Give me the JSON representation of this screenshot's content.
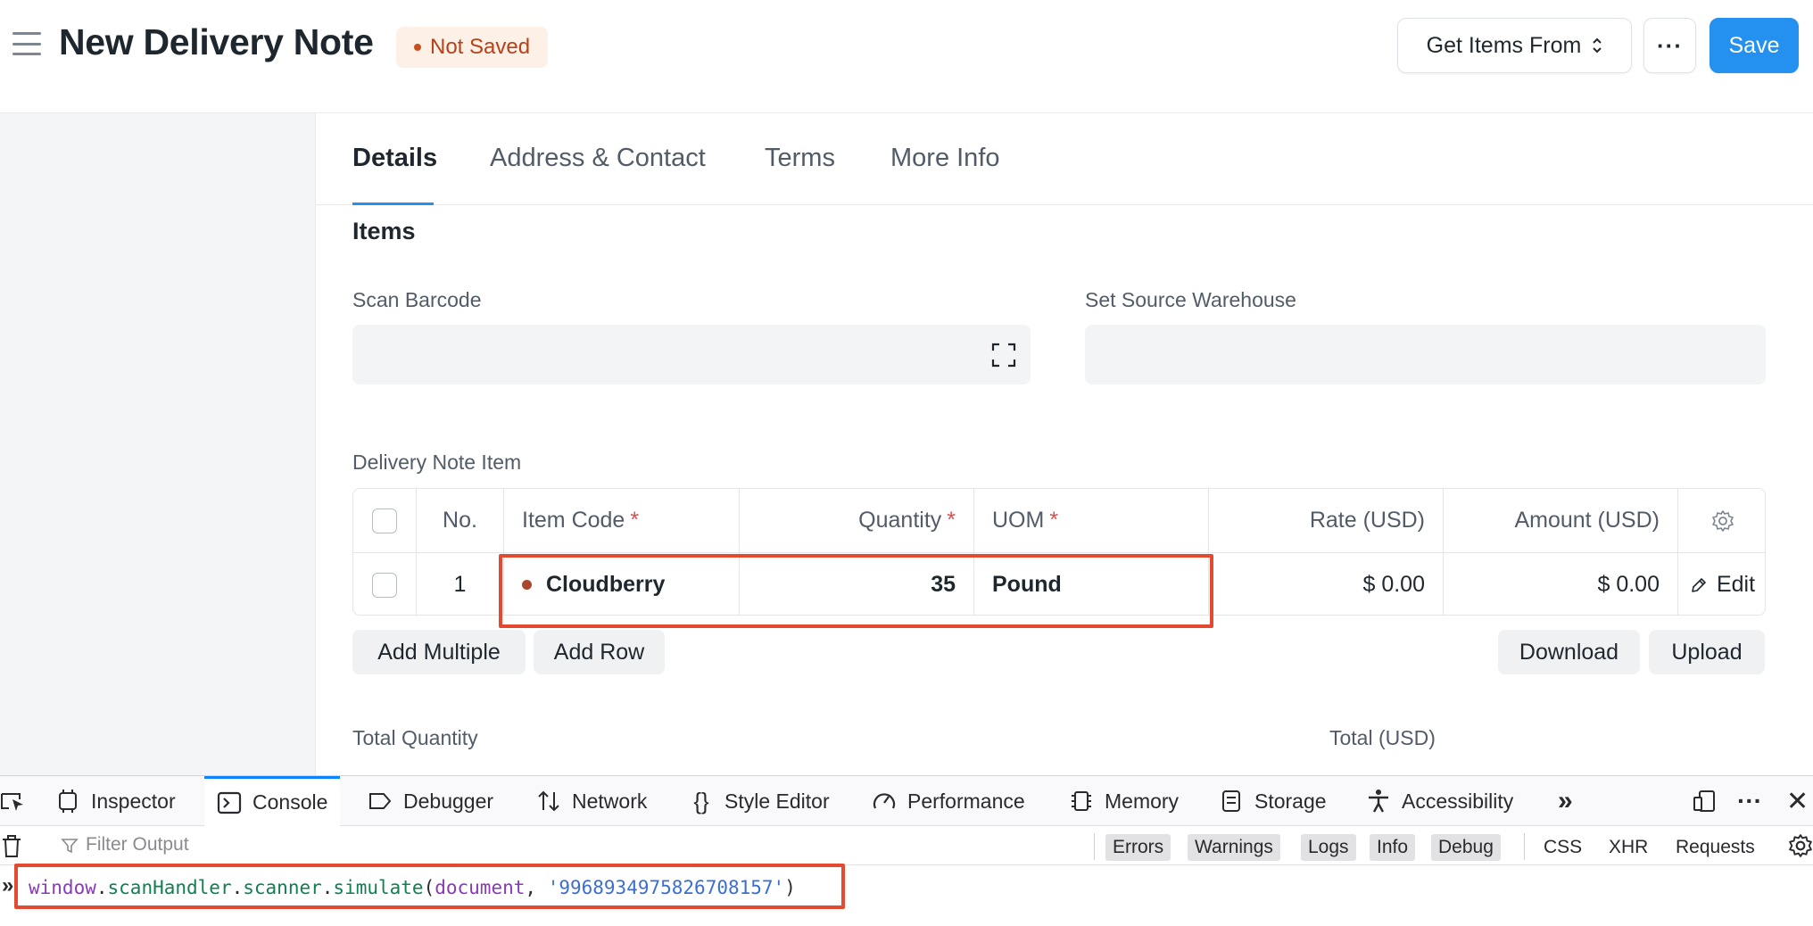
{
  "header": {
    "title": "New Delivery Note",
    "status": "Not Saved",
    "get_items_label": "Get Items From",
    "more_label": "···",
    "save_label": "Save"
  },
  "tabs": [
    "Details",
    "Address & Contact",
    "Terms",
    "More Info"
  ],
  "section": {
    "title": "Items",
    "scan_barcode_label": "Scan Barcode",
    "set_source_warehouse_label": "Set Source Warehouse"
  },
  "grid": {
    "label": "Delivery Note Item",
    "columns": {
      "no": "No.",
      "item_code": "Item Code",
      "quantity": "Quantity",
      "uom": "UOM",
      "rate": "Rate (USD)",
      "amount": "Amount (USD)",
      "required_mark": "*"
    },
    "rows": [
      {
        "no": "1",
        "item_code": "Cloudberry",
        "quantity": "35",
        "uom": "Pound",
        "rate": "$ 0.00",
        "amount": "$ 0.00",
        "edit": "Edit"
      }
    ],
    "buttons": {
      "add_multiple": "Add Multiple",
      "add_row": "Add Row",
      "download": "Download",
      "upload": "Upload"
    }
  },
  "totals": {
    "total_quantity_label": "Total Quantity",
    "total_usd_label": "Total (USD)"
  },
  "devtools": {
    "tabs": [
      "Inspector",
      "Console",
      "Debugger",
      "Network",
      "Style Editor",
      "Performance",
      "Memory",
      "Storage",
      "Accessibility"
    ],
    "active_tab": "Console",
    "filter_placeholder": "Filter Output",
    "log_filters": [
      "Errors",
      "Warnings",
      "Logs",
      "Info",
      "Debug"
    ],
    "request_filters": [
      "CSS",
      "XHR",
      "Requests"
    ],
    "console_input": {
      "obj": "window",
      "p1": "scanHandler",
      "p2": "scanner",
      "p3": "simulate",
      "arg1": "document",
      "arg2": "'9968934975826708157'"
    }
  },
  "colors": {
    "primary": "#2490ef",
    "highlight": "#e34a2f",
    "status_bg": "#fdf0e6",
    "status_text": "#b5421a"
  }
}
